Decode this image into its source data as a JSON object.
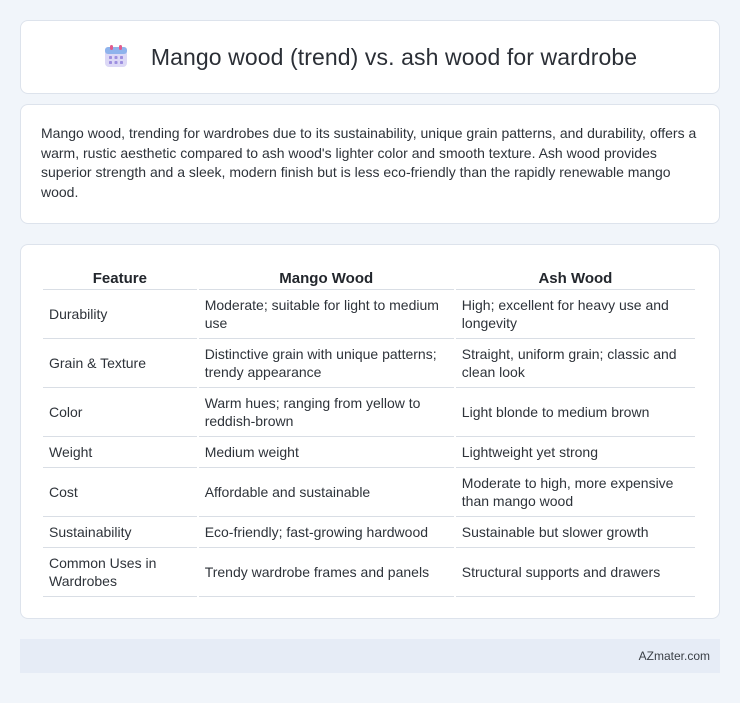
{
  "header": {
    "title": "Mango wood (trend) vs. ash wood for wardrobe",
    "icon": "calendar-icon"
  },
  "summary": {
    "text": "Mango wood, trending for wardrobes due to its sustainability, unique grain patterns, and durability, offers a warm, rustic aesthetic compared to ash wood's lighter color and smooth texture. Ash wood provides superior strength and a sleek, modern finish but is less eco-friendly than the rapidly renewable mango wood."
  },
  "table": {
    "headers": [
      "Feature",
      "Mango Wood",
      "Ash Wood"
    ],
    "rows": [
      [
        "Durability",
        "Moderate; suitable for light to medium use",
        "High; excellent for heavy use and longevity"
      ],
      [
        "Grain & Texture",
        "Distinctive grain with unique patterns; trendy appearance",
        "Straight, uniform grain; classic and clean look"
      ],
      [
        "Color",
        "Warm hues; ranging from yellow to reddish-brown",
        "Light blonde to medium brown"
      ],
      [
        "Weight",
        "Medium weight",
        "Lightweight yet strong"
      ],
      [
        "Cost",
        "Affordable and sustainable",
        "Moderate to high, more expensive than mango wood"
      ],
      [
        "Sustainability",
        "Eco-friendly; fast-growing hardwood",
        "Sustainable but slower growth"
      ],
      [
        "Common Uses in Wardrobes",
        "Trendy wardrobe frames and panels",
        "Structural supports and drawers"
      ]
    ]
  },
  "footer": {
    "brand": "AZmater.com"
  },
  "colors": {
    "background": "#f1f5fa",
    "card": "#ffffff",
    "footer_bg": "#e6ecf6",
    "icon_accent": "#8b7fd6"
  }
}
